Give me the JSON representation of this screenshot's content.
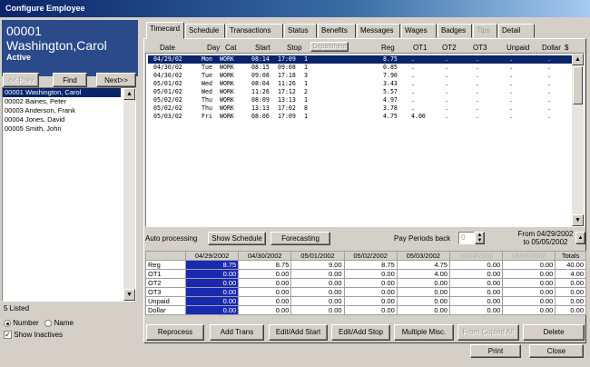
{
  "window": {
    "title": "Configure Employee"
  },
  "employee": {
    "id": "00001",
    "name": "Washington,Carol",
    "status": "Active"
  },
  "nav": {
    "prev_label": "<< Prev",
    "find_label": "Find",
    "next_label": "Next>>"
  },
  "employee_list": [
    "00001  Washington, Carol",
    "00002  Baines, Peter",
    "00003  Anderson, Frank",
    "00004  Jones, David",
    "00005  Smith, John"
  ],
  "listed_count": "5 Listed",
  "sort": {
    "number_label": "Number",
    "name_label": "Name",
    "selected": "number"
  },
  "show_inactives": {
    "label": "Show Inactives",
    "checked": true
  },
  "tabs": [
    "Timecard",
    "Schedule",
    "Transactions",
    "Status",
    "Benefits",
    "Messages",
    "Wages",
    "Badges",
    "Tips",
    "Detail"
  ],
  "timecard": {
    "columns": {
      "date": "Date",
      "day": "Day",
      "cat": "Cat",
      "start": "Start",
      "stop": "Stop",
      "department": "Department",
      "reg": "Reg",
      "ot1": "OT1",
      "ot2": "OT2",
      "ot3": "OT3",
      "unpaid": "Unpaid",
      "dollar": "Dollar",
      "s": "$"
    },
    "rows": [
      {
        "date": "04/29/02",
        "day": "Mon",
        "cat": "WORK",
        "start": "08:14",
        "stop": "17:09",
        "dept": "1",
        "reg": "8.75",
        "ot1": "."
      },
      {
        "date": "04/30/02",
        "day": "Tue",
        "cat": "WORK",
        "start": "08:15",
        "stop": "09:08",
        "dept": "1",
        "reg": "0.85",
        "ot1": "."
      },
      {
        "date": "04/30/02",
        "day": "Tue",
        "cat": "WORK",
        "start": "09:08",
        "stop": "17:18",
        "dept": "3",
        "reg": "7.90",
        "ot1": "."
      },
      {
        "date": "05/01/02",
        "day": "Wed",
        "cat": "WORK",
        "start": "08:04",
        "stop": "11:26",
        "dept": "1",
        "reg": "3.43",
        "ot1": "."
      },
      {
        "date": "05/01/02",
        "day": "Wed",
        "cat": "WORK",
        "start": "11:26",
        "stop": "17:12",
        "dept": "2",
        "reg": "5.57",
        "ot1": "."
      },
      {
        "date": "05/02/02",
        "day": "Thu",
        "cat": "WORK",
        "start": "08:09",
        "stop": "13:13",
        "dept": "1",
        "reg": "4.97",
        "ot1": "."
      },
      {
        "date": "05/02/02",
        "day": "Thu",
        "cat": "WORK",
        "start": "13:13",
        "stop": "17:02",
        "dept": "8",
        "reg": "3.78",
        "ot1": "."
      },
      {
        "date": "05/03/02",
        "day": "Fri",
        "cat": "WORK",
        "start": "08:06",
        "stop": "17:09",
        "dept": "1",
        "reg": "4.75",
        "ot1": "4.00"
      }
    ]
  },
  "toolbar": {
    "auto_processing": "Auto processing",
    "show_schedule": "Show Schedule",
    "forecasting": "Forecasting",
    "pay_periods_back": "Pay Periods back",
    "pay_periods_value": "0",
    "range_from": "From 04/29/2002",
    "range_to": "to 05/05/2002"
  },
  "summary": {
    "dates": [
      "04/29/2002",
      "04/30/2002",
      "05/01/2002",
      "05/02/2002",
      "05/03/2002",
      "05/04/2002",
      "05/05/2002"
    ],
    "totals_label": "Totals",
    "rows": [
      {
        "label": "Reg",
        "values": [
          "8.75",
          "8.75",
          "9.00",
          "8.75",
          "4.75",
          "0.00",
          "0.00"
        ],
        "total": "40.00"
      },
      {
        "label": "OT1",
        "values": [
          "0.00",
          "0.00",
          "0.00",
          "0.00",
          "4.00",
          "0.00",
          "0.00"
        ],
        "total": "4.00"
      },
      {
        "label": "OT2",
        "values": [
          "0.00",
          "0.00",
          "0.00",
          "0.00",
          "0.00",
          "0.00",
          "0.00"
        ],
        "total": "0.00"
      },
      {
        "label": "OT3",
        "values": [
          "0.00",
          "0.00",
          "0.00",
          "0.00",
          "0.00",
          "0.00",
          "0.00"
        ],
        "total": "0.00"
      },
      {
        "label": "Unpaid",
        "values": [
          "0.00",
          "0.00",
          "0.00",
          "0.00",
          "0.00",
          "0.00",
          "0.00"
        ],
        "total": "0.00"
      },
      {
        "label": "Dollar",
        "values": [
          "0.00",
          "0.00",
          "0.00",
          "0.00",
          "0.00",
          "0.00",
          "0.00"
        ],
        "total": "0.00"
      }
    ]
  },
  "actions": {
    "reprocess": "Reprocess",
    "add_trans": "Add Trans",
    "edit_add_start": "Edit/Add Start",
    "edit_add_stop": "Edit/Add Stop",
    "multiple_misc": "Multiple Misc.",
    "from_copied": "From Copied All",
    "delete": "Delete",
    "print": "Print",
    "close": "Close"
  }
}
